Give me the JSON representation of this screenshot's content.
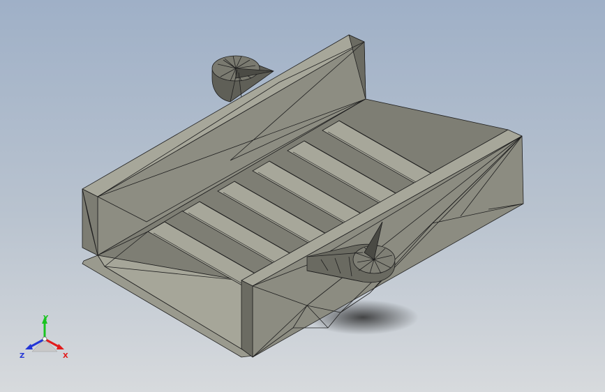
{
  "viewport": {
    "background_top": "#9fb0c7",
    "background_bottom": "#d7dadd"
  },
  "model": {
    "description_icon": "tray-with-slots-mesh",
    "face_colors": {
      "light": "#a7a79a",
      "mid": "#8a8a7e",
      "dark": "#6b6b62",
      "edge": "#1e1e1e"
    }
  },
  "triad": {
    "x_label": "X",
    "y_label": "Y",
    "z_label": "Z",
    "x_color": "#e21b1b",
    "y_color": "#19c41f",
    "z_color": "#2336d6"
  }
}
